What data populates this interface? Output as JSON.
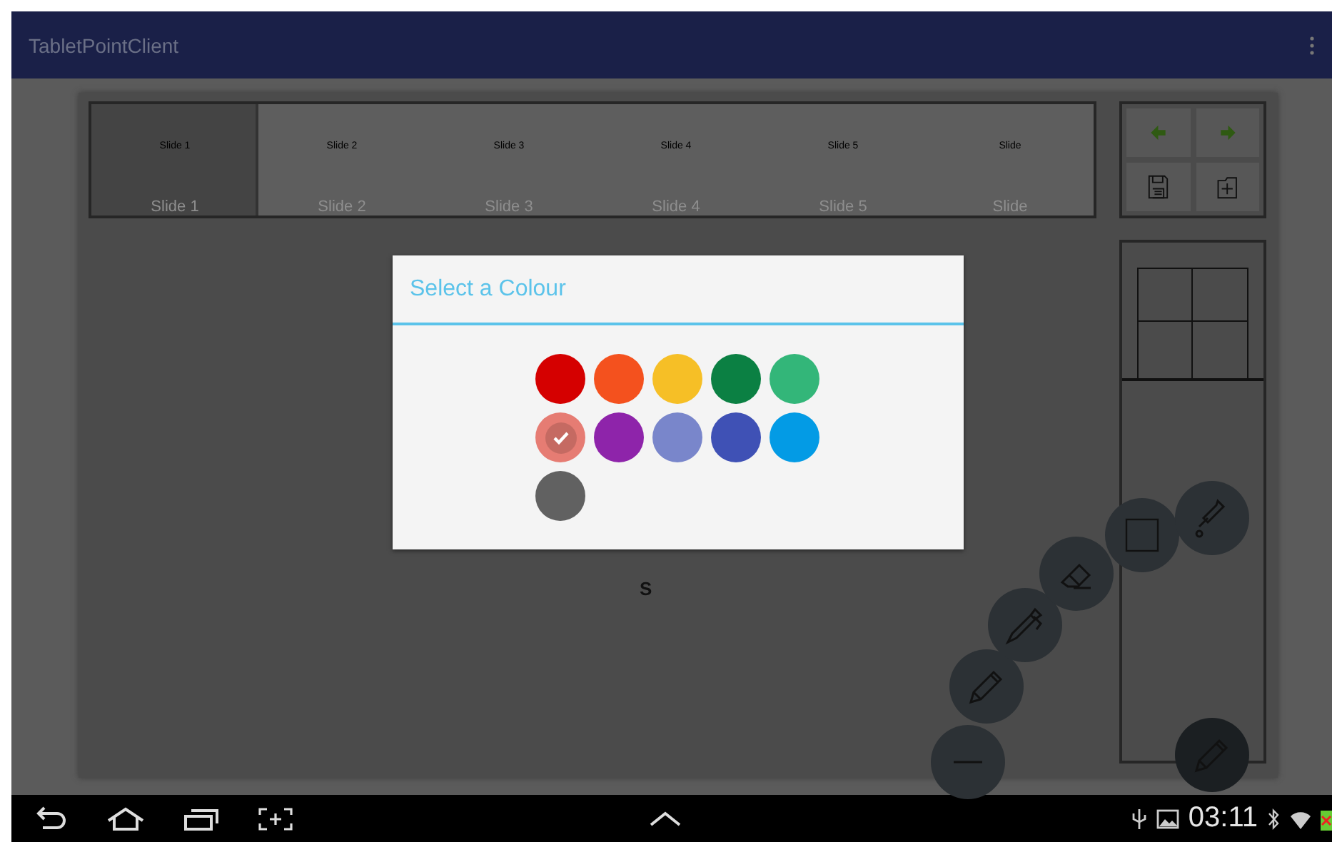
{
  "app_bar": {
    "title": "TabletPointClient"
  },
  "slides": [
    {
      "thumb_label": "Slide 1",
      "label": "Slide 1",
      "selected": true
    },
    {
      "thumb_label": "Slide 2",
      "label": "Slide 2",
      "selected": false
    },
    {
      "thumb_label": "Slide 3",
      "label": "Slide 3",
      "selected": false
    },
    {
      "thumb_label": "Slide 4",
      "label": "Slide 4",
      "selected": false
    },
    {
      "thumb_label": "Slide 5",
      "label": "Slide 5",
      "selected": false
    },
    {
      "thumb_label": "Slide",
      "label": "Slide",
      "selected": false
    }
  ],
  "canvas": {
    "text": "S"
  },
  "dialog": {
    "title": "Select a Colour",
    "colours": [
      {
        "color": "#d50000",
        "selected": false
      },
      {
        "color": "#f4511e",
        "selected": false
      },
      {
        "color": "#f6bf26",
        "selected": false
      },
      {
        "color": "#0b8043",
        "selected": false
      },
      {
        "color": "#33b679",
        "selected": false
      },
      {
        "color": "#e67c73",
        "selected": true
      },
      {
        "color": "#8e24aa",
        "selected": false
      },
      {
        "color": "#7986cb",
        "selected": false
      },
      {
        "color": "#3f51b5",
        "selected": false
      },
      {
        "color": "#039be5",
        "selected": false
      },
      {
        "color": "#616161",
        "selected": false
      }
    ]
  },
  "status_bar": {
    "time": "03:11"
  }
}
